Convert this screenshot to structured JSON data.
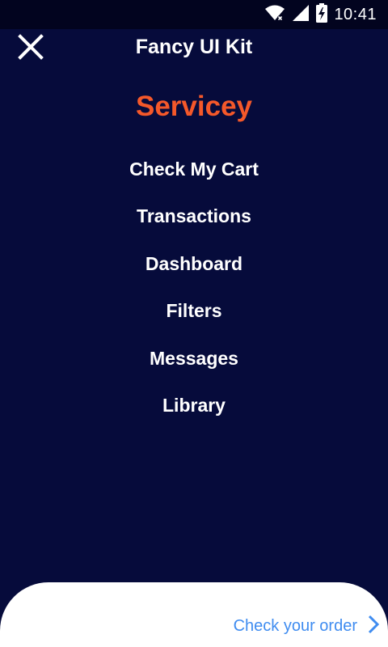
{
  "status_bar": {
    "time": "10:41",
    "icons": [
      "wifi-icon",
      "signal-icon",
      "battery-charging-icon"
    ]
  },
  "app_bar": {
    "title": "Fancy UI Kit",
    "close_icon": "close-icon"
  },
  "brand": {
    "name": "Servicey",
    "color": "#f4582a"
  },
  "menu": {
    "items": [
      {
        "label": "Check My Cart"
      },
      {
        "label": "Transactions"
      },
      {
        "label": "Dashboard"
      },
      {
        "label": "Filters"
      },
      {
        "label": "Messages"
      },
      {
        "label": "Library"
      }
    ]
  },
  "bottom_sheet": {
    "link_label": "Check your order",
    "link_icon": "chevron-right-icon",
    "link_color": "#3f8cf0"
  },
  "colors": {
    "background": "#060b3b",
    "status_bar": "#02041f"
  }
}
